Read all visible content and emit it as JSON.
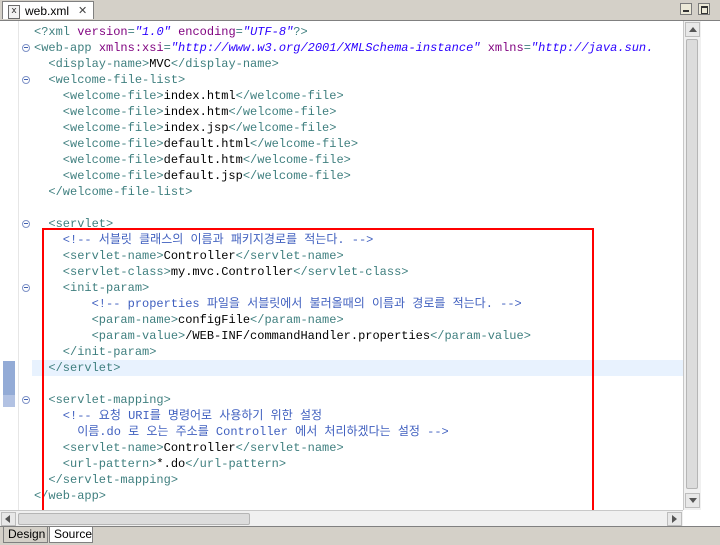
{
  "tab": {
    "title": "web.xml",
    "icon": "xml-file-icon",
    "close_glyph": "✕"
  },
  "code_lines": [
    [
      "<?xml ",
      [
        "a",
        "version"
      ],
      "=",
      [
        "v",
        "\"1.0\""
      ],
      " ",
      [
        "a",
        "encoding"
      ],
      "=",
      [
        "v",
        "\"UTF-8\""
      ],
      "?>"
    ],
    [
      "<web-app ",
      [
        "a",
        "xmlns:xsi"
      ],
      "=",
      [
        "v",
        "\"http://www.w3.org/2001/XMLSchema-instance\""
      ],
      " ",
      [
        "a",
        "xmlns"
      ],
      "=",
      [
        "v",
        "\"http://java.sun."
      ]
    ],
    [
      "  <display-name>",
      [
        "x",
        "MVC"
      ],
      "</display-name>"
    ],
    [
      "  <welcome-file-list>"
    ],
    [
      "    <welcome-file>",
      [
        "x",
        "index.html"
      ],
      "</welcome-file>"
    ],
    [
      "    <welcome-file>",
      [
        "x",
        "index.htm"
      ],
      "</welcome-file>"
    ],
    [
      "    <welcome-file>",
      [
        "x",
        "index.jsp"
      ],
      "</welcome-file>"
    ],
    [
      "    <welcome-file>",
      [
        "x",
        "default.html"
      ],
      "</welcome-file>"
    ],
    [
      "    <welcome-file>",
      [
        "x",
        "default.htm"
      ],
      "</welcome-file>"
    ],
    [
      "    <welcome-file>",
      [
        "x",
        "default.jsp"
      ],
      "</welcome-file>"
    ],
    [
      "  </welcome-file-list>"
    ],
    [
      ""
    ],
    [
      "  <servlet>"
    ],
    [
      [
        "c",
        "    <!-- 서블릿 클래스의 이름과 패키지경로를 적는다. -->"
      ]
    ],
    [
      "    <servlet-name>",
      [
        "x",
        "Controller"
      ],
      "</servlet-name>"
    ],
    [
      "    <servlet-class>",
      [
        "x",
        "my.mvc.Controller"
      ],
      "</servlet-class>"
    ],
    [
      "    <init-param>"
    ],
    [
      [
        "c",
        "        <!-- properties 파일을 서블릿에서 불러올때의 이름과 경로를 적는다. -->"
      ]
    ],
    [
      "        <param-name>",
      [
        "x",
        "configFile"
      ],
      "</param-name>"
    ],
    [
      "        <param-value>",
      [
        "x",
        "/WEB-INF/commandHandler.properties"
      ],
      "</param-value>"
    ],
    [
      "    </init-param>"
    ],
    [
      "  </servlet>"
    ],
    [
      ""
    ],
    [
      "  <servlet-mapping>"
    ],
    [
      [
        "c",
        "    <!-- 요청 URI를 명령어로 사용하기 위한 설정"
      ]
    ],
    [
      [
        "c",
        "      이름.do 로 오는 주소를 Controller 에서 처리하겠다는 설정 -->"
      ]
    ],
    [
      "    <servlet-name>",
      [
        "x",
        "Controller"
      ],
      "</servlet-name>"
    ],
    [
      "    <url-pattern>",
      [
        "x",
        "*.do"
      ],
      "</url-pattern>"
    ],
    [
      "  </servlet-mapping>"
    ],
    [
      "</web-app>"
    ]
  ],
  "current_line_index": 21,
  "fold_lines": [
    1,
    3,
    12,
    16,
    23
  ],
  "bottom_tabs": {
    "design": "Design",
    "source": "Source",
    "active": "Source"
  },
  "colors": {
    "tag": "#3f7f7f",
    "attribute": "#7f007f",
    "attribute_value": "#2a00ff",
    "comment": "#3f5fbf",
    "highlight_border": "#ff0000",
    "current_line": "#e8f2fe"
  }
}
